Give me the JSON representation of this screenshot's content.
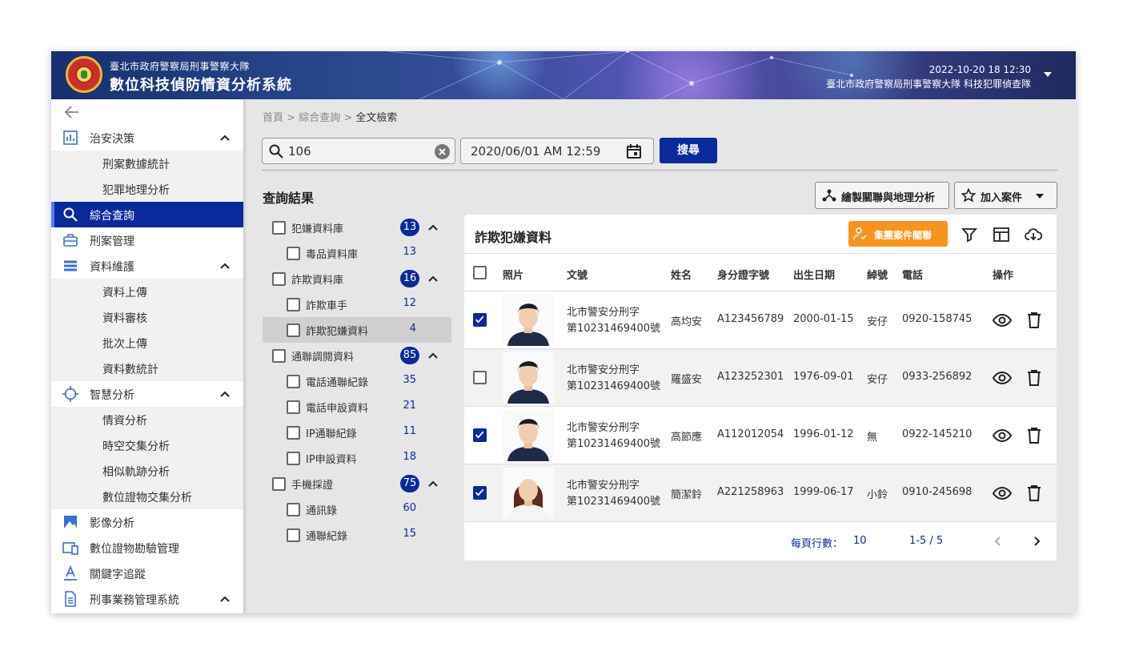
{
  "header": {
    "org": "臺北市政府警察局刑事警察大隊",
    "system_title": "數位科技偵防情資分析系統",
    "datetime": "2022-10-20 18  12:30",
    "user_unit": "臺北市政府警察局刑事警察大隊 科技犯罪偵查隊"
  },
  "sidebar": {
    "items": [
      {
        "label": "治安決策",
        "icon": "bar-chart-icon",
        "expandable": true
      },
      {
        "label": "刑案數據統計"
      },
      {
        "label": "犯罪地理分析"
      },
      {
        "label": "綜合查詢",
        "icon": "search-icon",
        "active": true
      },
      {
        "label": "刑案管理",
        "icon": "briefcase-icon"
      },
      {
        "label": "資料維護",
        "icon": "list-icon",
        "expandable": true
      },
      {
        "label": "資料上傳"
      },
      {
        "label": "資料審核"
      },
      {
        "label": "批次上傳"
      },
      {
        "label": "資料數統計"
      },
      {
        "label": "智慧分析",
        "icon": "crosshair-icon",
        "expandable": true
      },
      {
        "label": "情資分析"
      },
      {
        "label": "時空交集分析"
      },
      {
        "label": "相似軌跡分析"
      },
      {
        "label": "數位證物交集分析"
      },
      {
        "label": "影像分析",
        "icon": "image-icon"
      },
      {
        "label": "數位證物勘驗管理",
        "icon": "devices-icon"
      },
      {
        "label": "關鍵字追蹤",
        "icon": "text-icon"
      },
      {
        "label": "刑事業務管理系統",
        "icon": "document-icon",
        "expandable": true
      }
    ]
  },
  "breadcrumb": {
    "home": "首頁",
    "parent": "綜合查詢",
    "current": "全文檢索",
    "sep": " > "
  },
  "search": {
    "value": "106",
    "date_value": "2020/06/01 AM 12:59",
    "button_label": "搜尋"
  },
  "results": {
    "title": "查詢結果",
    "relation_button": "繪製關聯與地理分析",
    "add_case_button": "加入案件"
  },
  "tree": [
    {
      "label": "犯嫌資料庫",
      "count": "13",
      "level": 0
    },
    {
      "label": "毒品資料庫",
      "count": "13",
      "level": 1
    },
    {
      "label": "詐欺資料庫",
      "count": "16",
      "level": 0
    },
    {
      "label": "詐欺車手",
      "count": "12",
      "level": 1
    },
    {
      "label": "詐欺犯嫌資料",
      "count": "4",
      "level": 1,
      "selected": true
    },
    {
      "label": "通聯調閱資料",
      "count": "85",
      "level": 0
    },
    {
      "label": "電話通聯紀錄",
      "count": "35",
      "level": 1
    },
    {
      "label": "電話申設資料",
      "count": "21",
      "level": 1
    },
    {
      "label": "IP通聯紀錄",
      "count": "11",
      "level": 1
    },
    {
      "label": "IP申設資料",
      "count": "18",
      "level": 1
    },
    {
      "label": "手機採證",
      "count": "75",
      "level": 0
    },
    {
      "label": "通訊錄",
      "count": "60",
      "level": 1
    },
    {
      "label": "通聯紀錄",
      "count": "15",
      "level": 1
    }
  ],
  "panel": {
    "title": "詐欺犯嫌資料",
    "group_button": "集團案件關聯",
    "columns": [
      "照片",
      "文號",
      "姓名",
      "身分證字號",
      "出生日期",
      "綽號",
      "電話",
      "操作"
    ],
    "rows": [
      {
        "checked": true,
        "doc1": "北市警安分刑字",
        "doc2": "第10231469400號",
        "name": "高均安",
        "id": "A123456789",
        "dob": "2000-01-15",
        "nick": "安仔",
        "phone": "0920-158745",
        "photo": "male"
      },
      {
        "checked": false,
        "doc1": "北市警安分刑字",
        "doc2": "第10231469400號",
        "name": "羅盛安",
        "id": "A123252301",
        "dob": "1976-09-01",
        "nick": "安仔",
        "phone": "0933-256892",
        "photo": "male"
      },
      {
        "checked": true,
        "doc1": "北市警安分刑字",
        "doc2": "第10231469400號",
        "name": "高節應",
        "id": "A112012054",
        "dob": "1996-01-12",
        "nick": "無",
        "phone": "0922-145210",
        "photo": "male"
      },
      {
        "checked": true,
        "doc1": "北市警安分刑字",
        "doc2": "第10231469400號",
        "name": "簡潔鈴",
        "id": "A221258963",
        "dob": "1999-06-17",
        "nick": "小鈴",
        "phone": "0910-245698",
        "photo": "female"
      }
    ],
    "rows_per_page_label": "每頁行數：",
    "rows_per_page": "10",
    "range": "1-5 / 5"
  },
  "colors": {
    "primary": "#0a2a9b",
    "accent_orange": "#f7941d"
  }
}
